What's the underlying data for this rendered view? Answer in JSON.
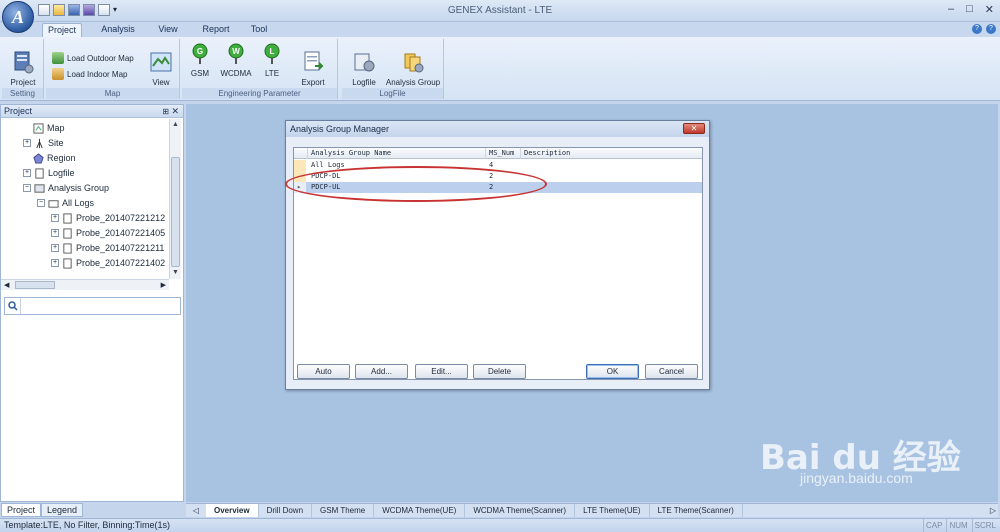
{
  "app": {
    "title": "GENEX Assistant - LTE",
    "orb_letter": "A",
    "qat_drop": "▾",
    "window_controls": [
      "–",
      "□",
      "✕"
    ]
  },
  "ribbon": {
    "tabs": [
      "Project",
      "Analysis",
      "View",
      "Report",
      "Tool"
    ],
    "active_tab": "Project",
    "help_icons": [
      "?",
      "?"
    ],
    "groups": {
      "setting": {
        "label": "Setting",
        "project_setting": "Project\nSetting"
      },
      "map": {
        "label": "Map",
        "load_outdoor": "Load Outdoor Map",
        "load_indoor": "Load Indoor Map",
        "view_map": "View\nMap"
      },
      "engineering": {
        "label": "Engineering Parameter",
        "gsm": "GSM",
        "wcdma": "WCDMA",
        "lte": "LTE",
        "export_template": "Export\nTemplate▾"
      },
      "logfile": {
        "label": "LogFile",
        "logfile_manager": "Logfile\nManager",
        "analysis_group_manager": "Analysis Group\nManager"
      }
    }
  },
  "project_panel": {
    "title": "Project",
    "pin": "⊞",
    "close": "✕",
    "tree": [
      {
        "label": "Map",
        "expander": ""
      },
      {
        "label": "Site",
        "expander": "+"
      },
      {
        "label": "Region",
        "expander": ""
      },
      {
        "label": "Logfile",
        "expander": "+"
      },
      {
        "label": "Analysis Group",
        "expander": "−"
      },
      {
        "label": "All Logs",
        "expander": "−"
      },
      {
        "label": "Probe_201407221212",
        "expander": "+"
      },
      {
        "label": "Probe_201407221405",
        "expander": "+"
      },
      {
        "label": "Probe_201407221211",
        "expander": "+"
      },
      {
        "label": "Probe_201407221402",
        "expander": "+"
      }
    ],
    "bottom_tabs": [
      "Project",
      "Legend"
    ],
    "search_value": ""
  },
  "dialog": {
    "title": "Analysis Group Manager",
    "close": "✕",
    "columns": [
      "Analysis Group Name",
      "MS_Num",
      "Description"
    ],
    "rows": [
      {
        "name": "All Logs",
        "ms_num": "4",
        "description": ""
      },
      {
        "name": "PDCP-DL",
        "ms_num": "2",
        "description": ""
      },
      {
        "name": "PDCP-UL",
        "ms_num": "2",
        "description": ""
      }
    ],
    "selected_marker": "▸",
    "buttons": {
      "auto": "Auto",
      "add": "Add...",
      "edit": "Edit...",
      "delete": "Delete",
      "ok": "OK",
      "cancel": "Cancel"
    }
  },
  "doc_tabs": {
    "left_arrow": "◁",
    "right_arrow": "▷",
    "items": [
      "Overview",
      "Drill Down",
      "GSM Theme",
      "WCDMA Theme(UE)",
      "WCDMA Theme(Scanner)",
      "LTE Theme(UE)",
      "LTE Theme(Scanner)"
    ],
    "active": "Overview"
  },
  "status": {
    "text": "Template:LTE,  No Filter,  Binning:Time(1s)",
    "indicators": [
      "CAP",
      "NUM",
      "SCRL"
    ]
  },
  "watermark": {
    "text": "Bai du 经验",
    "url": "jingyan.baidu.com"
  }
}
